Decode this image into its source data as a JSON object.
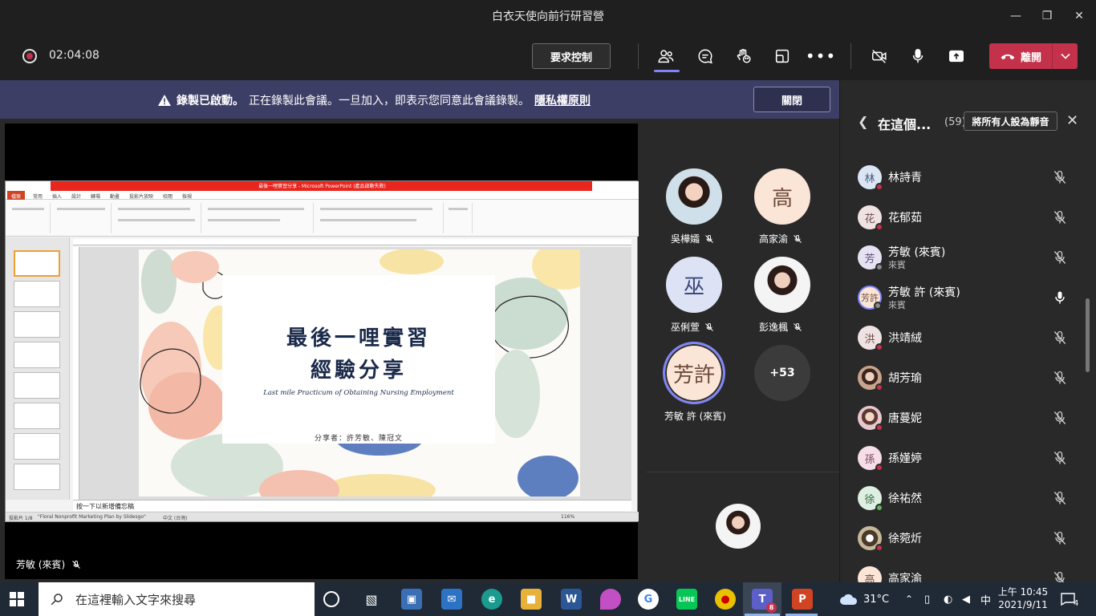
{
  "window": {
    "title": "白衣天使向前行研習營"
  },
  "toolbar": {
    "timer": "02:04:08",
    "request_control": "要求控制",
    "leave": "離開"
  },
  "banner": {
    "started": "錄製已啟動。",
    "message": "正在錄製此會議。一旦加入，即表示您同意此會議錄製。",
    "privacy": "隱私權原則",
    "close": "關閉"
  },
  "share": {
    "presenter": "芳敏 (來賓)"
  },
  "ppt": {
    "titlebar": "最後一哩實習分享 - Microsoft PowerPoint (產品啟動失敗)",
    "tabs": [
      "檔案",
      "常用",
      "插入",
      "設計",
      "轉場",
      "動畫",
      "投影片放映",
      "校閱",
      "檢視"
    ],
    "slide": {
      "title1": "最後一哩實習",
      "title2": "經驗分享",
      "subtitle": "Last mile Practicum of Obtaining Nursing Employment",
      "author": "分享者：許芳敏、陳冠文"
    },
    "notes": "按一下以新增備忘稿",
    "status_slide": "投影片 1/8",
    "status_theme": "\"Floral Nonprofit Marketing Plan by Slidesgo\"",
    "status_lang": "中文 (台灣)",
    "status_zoom": "116%"
  },
  "gallery": [
    {
      "name": "吳樺孀",
      "initials": ""
    },
    {
      "name": "高家渝",
      "initials": "高"
    },
    {
      "name": "巫俐萱",
      "initials": "巫"
    },
    {
      "name": "彭逸楓",
      "initials": ""
    },
    {
      "name": "芳敏 許 (來賓)",
      "initials": "芳許"
    },
    {
      "name": "",
      "initials": "+53"
    }
  ],
  "panel": {
    "title": "在這個...",
    "count": "(59)",
    "mute_all": "將所有人設為靜音",
    "participants": [
      {
        "name": "林詩青",
        "initial": "林",
        "sub": ""
      },
      {
        "name": "花郁茹",
        "initial": "花",
        "sub": ""
      },
      {
        "name": "芳敏 (來賓)",
        "initial": "芳",
        "sub": "來賓"
      },
      {
        "name": "芳敏 許 (來賓)",
        "initial": "芳許",
        "sub": "來賓"
      },
      {
        "name": "洪靖絨",
        "initial": "洪",
        "sub": ""
      },
      {
        "name": "胡芳瑜",
        "initial": "",
        "sub": ""
      },
      {
        "name": "唐蔓妮",
        "initial": "",
        "sub": ""
      },
      {
        "name": "孫嫤婷",
        "initial": "孫",
        "sub": ""
      },
      {
        "name": "徐祐然",
        "initial": "徐",
        "sub": ""
      },
      {
        "name": "徐菀炘",
        "initial": "",
        "sub": ""
      },
      {
        "name": "高家渝",
        "initial": "高",
        "sub": ""
      }
    ]
  },
  "taskbar": {
    "search_placeholder": "在這裡輸入文字來搜尋",
    "weather": "31°C",
    "ime": "中",
    "time": "上午 10:45",
    "date": "2021/9/11",
    "notifications": "4",
    "teams_badge": "8"
  },
  "colors": {
    "accent": "#7f85f5",
    "leave": "#c4314b",
    "banner": "#3d3e66",
    "panel": "#292929"
  }
}
